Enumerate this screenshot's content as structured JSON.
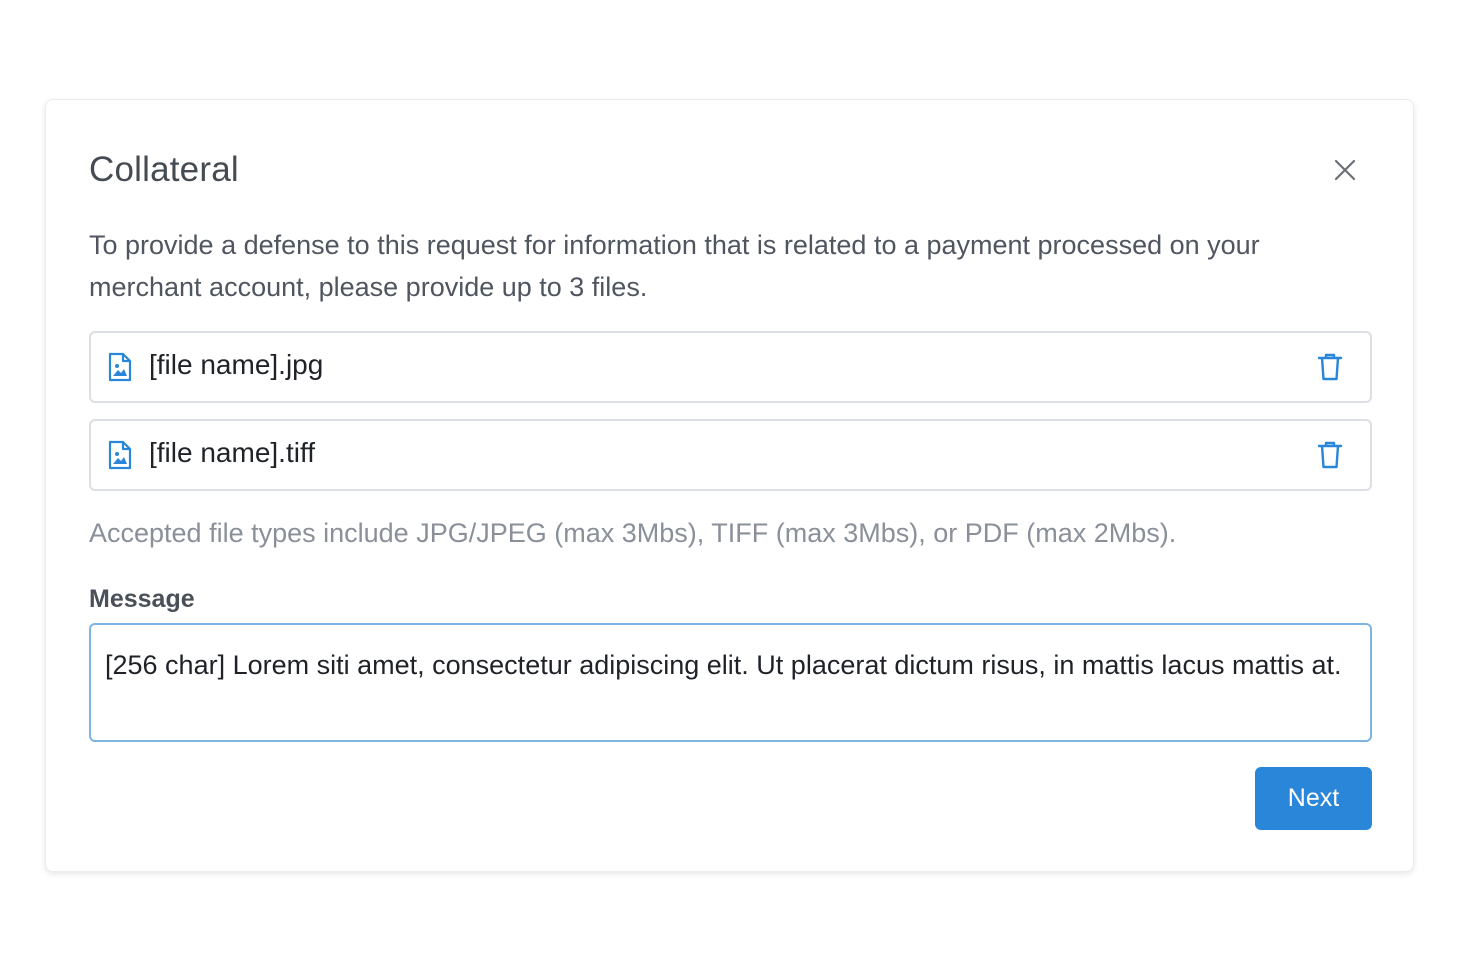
{
  "modal": {
    "title": "Collateral",
    "description": "To provide a defense to this request for information that is related to a payment processed on your merchant account, please provide up to 3 files.",
    "files": [
      {
        "name": "[file name].jpg",
        "icon": "image-file-icon",
        "action_icon": "trash-icon"
      },
      {
        "name": "[file name].tiff",
        "icon": "image-file-icon",
        "action_icon": "trash-icon"
      }
    ],
    "accepted_types_hint": "Accepted file types include JPG/JPEG (max 3Mbs), TIFF (max 3Mbs), or PDF (max 2Mbs).",
    "message_label": "Message",
    "message_value": "[256 char] Lorem siti amet, consectetur adipiscing elit. Ut placerat dictum risus, in mattis lacus mattis at.",
    "next_label": "Next",
    "close_icon": "close-icon"
  },
  "colors": {
    "accent": "#2a86d8",
    "focus_border": "#7fb4e2",
    "title_text": "#454b52",
    "hint_text": "#8a9099"
  }
}
